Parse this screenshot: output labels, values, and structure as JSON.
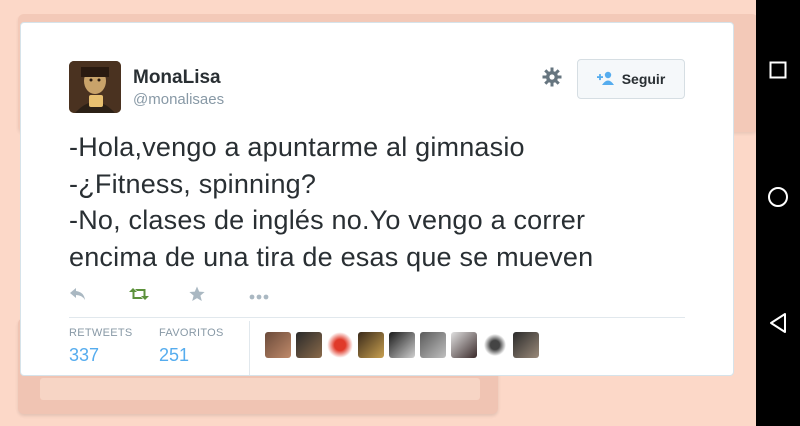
{
  "tweet": {
    "display_name": "MonaLisa",
    "handle": "@monalisaes",
    "follow_label": "Seguir",
    "text_lines": [
      "-Hola,vengo a apuntarme al gimnasio",
      "-¿Fitness, spinning?",
      "-No, clases de inglés no.Yo vengo a correr",
      "encima de una tira de esas que se mueven"
    ],
    "stats": {
      "retweets_label": "RETWEETS",
      "retweets_value": "337",
      "favorites_label": "FAVORITOS",
      "favorites_value": "251"
    }
  },
  "icons": {
    "reply": "reply-icon",
    "retweet": "retweet-icon",
    "favorite": "star-icon",
    "more": "more-icon",
    "settings": "gear-icon",
    "follow": "add-user-icon"
  },
  "colors": {
    "accent": "#55acee",
    "retweet_green": "#5c913b",
    "background": "#fcd8c8"
  },
  "android_nav": [
    "recents-button",
    "home-button",
    "back-button"
  ]
}
